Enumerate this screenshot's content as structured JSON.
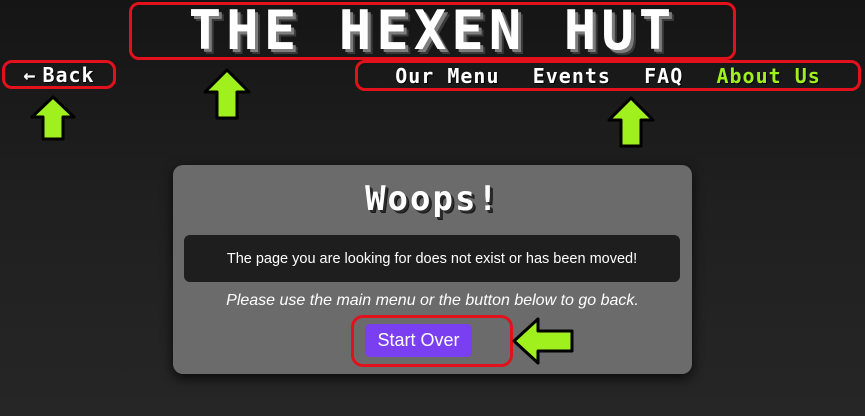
{
  "header": {
    "title": "THE HEXEN HUT",
    "back_label": "Back",
    "back_icon": "left-arrow-icon"
  },
  "nav": {
    "items": [
      {
        "label": "Our Menu",
        "active": false
      },
      {
        "label": "Events",
        "active": false
      },
      {
        "label": "FAQ",
        "active": false
      },
      {
        "label": "About Us",
        "active": true
      }
    ]
  },
  "error_card": {
    "heading": "Woops!",
    "message": "The page you are looking for does not exist or has been moved!",
    "hint": "Please use the main menu or the button below to go back.",
    "button_label": "Start Over"
  },
  "annotations": {
    "highlight_color": "#e2111c",
    "arrow_color": "#9ff01d",
    "arrow_icon": "green-arrow-icon"
  },
  "colors": {
    "background": "#1f1f1f",
    "card": "#6b6b6b",
    "message_bg": "#1e1e1e",
    "accent": "#9ff01d",
    "button": "#7b3ff2"
  }
}
